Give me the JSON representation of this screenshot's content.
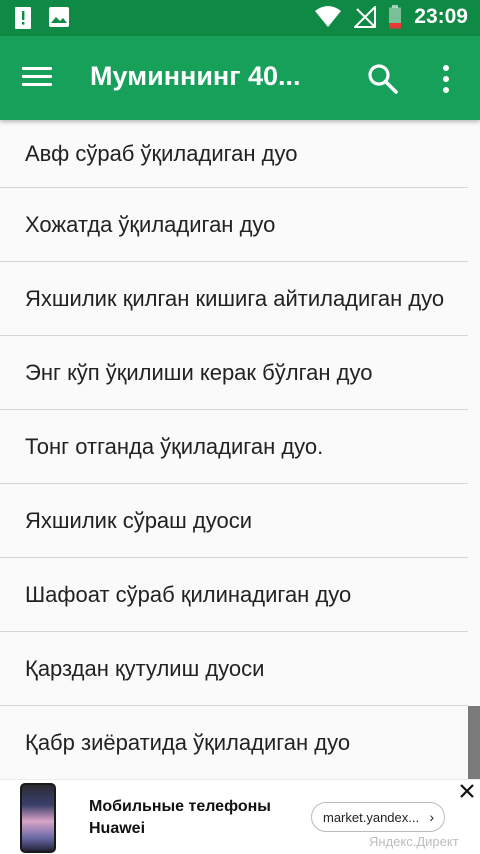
{
  "status_bar": {
    "time": "23:09",
    "icons": [
      "alert-icon",
      "image-icon",
      "wifi-icon",
      "no-signal-icon",
      "battery-low-icon"
    ]
  },
  "app_bar": {
    "title": "Муминнинг 40...",
    "icons": [
      "menu-icon",
      "search-icon",
      "more-vert-icon"
    ],
    "color": "#16a05a",
    "status_color": "#0f8a45"
  },
  "list": {
    "items": [
      "Авф сўраб ўқиладиган дуо",
      "Хожатда ўқиладиган дуо",
      "Яхшилик қилган кишига айтиладиган дуо",
      "Энг кўп ўқилиши керак бўлган дуо",
      "Тонг отганда ўқиладиган дуо.",
      "Яхшилик сўраш дуоси",
      "Шафоат сўраб қилинадиган дуо",
      "Қарздан қутулиш дуоси",
      "Қабр зиёратида ўқиладиган дуо"
    ]
  },
  "ad": {
    "title": "Мобильные телефоны Huawei",
    "link": "market.yandex...",
    "source": "Яндекс.Директ"
  }
}
